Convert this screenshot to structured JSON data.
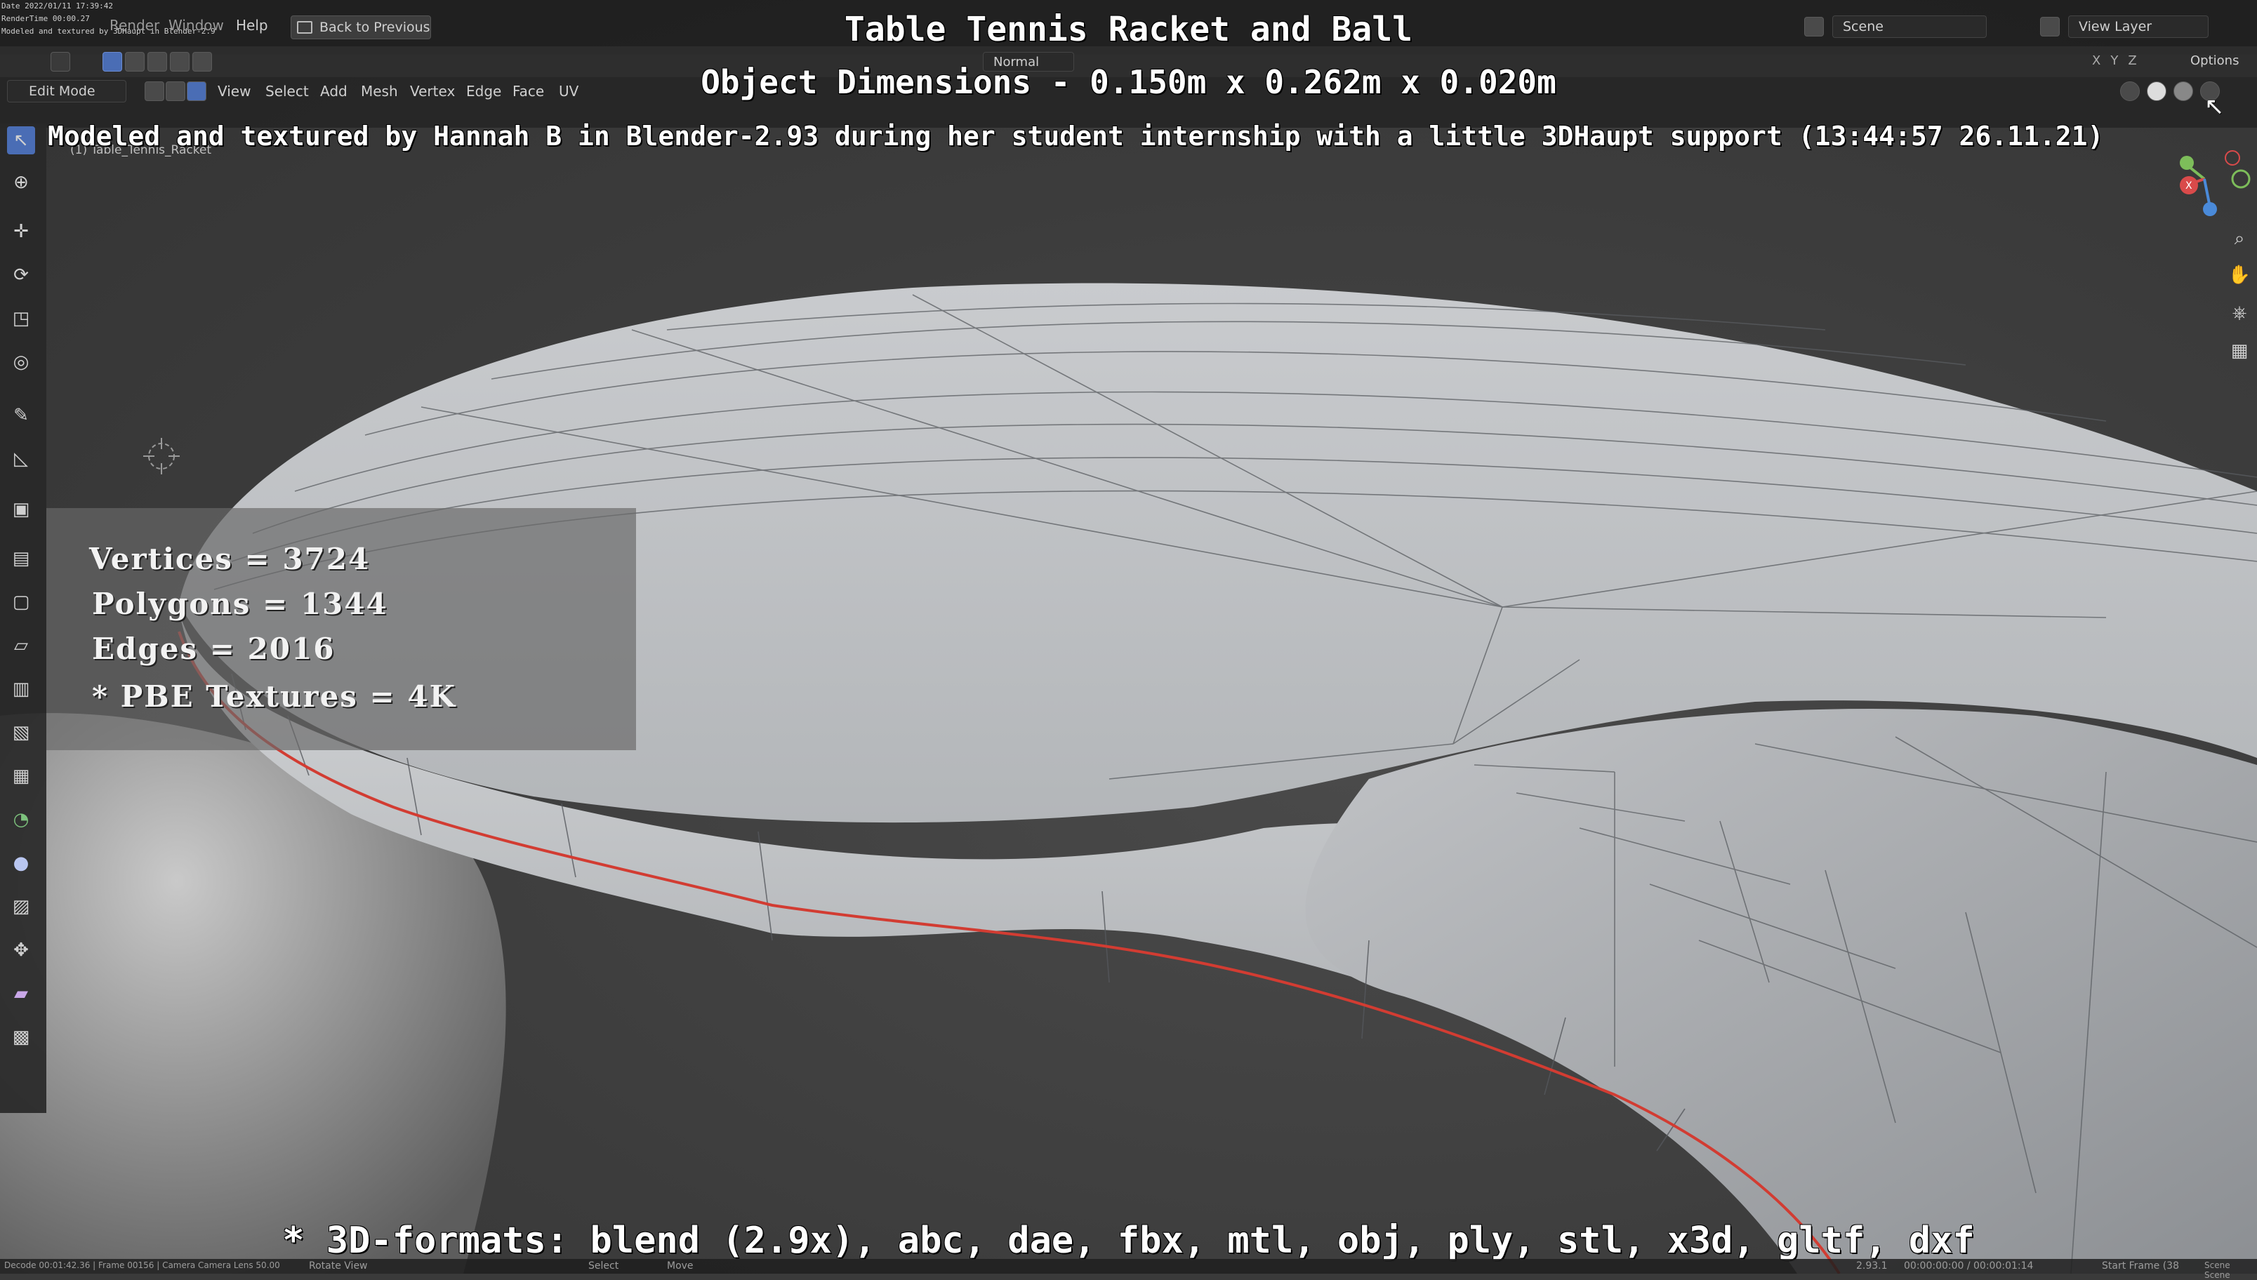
{
  "overlay": {
    "title": "Table Tennis Racket and Ball",
    "dimensions": "Object Dimensions -  0.150m x 0.262m x 0.020m",
    "credit": "Modeled and textured by Hannah B in Blender-2.93 during her student internship with a little 3DHaupt support (13:44:57 26.11.21)",
    "formats": "* 3D-formats: blend (2.9x), abc, dae, fbx, mtl, obj, ply, stl, x3d, gltf, dxf"
  },
  "stamp": {
    "date": "Date 2022/01/11 17:39:42",
    "render_time": "RenderTime 00:00.27",
    "modeled": "Modeled and textured by 3DHaupt in Blender-2.9"
  },
  "topbar": {
    "menus": [
      "Render",
      "Window",
      "Help"
    ],
    "back_label": "Back to Previous",
    "scene_label": "Scene",
    "view_layer_label": "View Layer",
    "options_label": "Options",
    "orientation_label": "Normal",
    "axes": [
      "X",
      "Y",
      "Z"
    ]
  },
  "header": {
    "mode_label": "Edit Mode",
    "menus": [
      "View",
      "Select",
      "Add",
      "Mesh",
      "Vertex",
      "Edge",
      "Face",
      "UV"
    ],
    "object_label": "(1) Table_Tennis_Racket"
  },
  "stats": {
    "vertices": "Vertices = 3724",
    "polygons": "Polygons = 1344",
    "edges": "Edges = 2016",
    "textures": "* PBE Textures = 4K"
  },
  "statusbar": {
    "left": "Decode 00:01:42.36 | Frame 00156 | Camera Camera   Lens 50.00",
    "rotate": "Rotate View",
    "select": "Select",
    "move": "Move",
    "version": "2.93.1",
    "time": "00:00:00:00 / 00:00:01:14",
    "start_frame": "Start Frame (38",
    "scene": "Scene  Scene"
  },
  "colors": {
    "accent": "#4a6db5",
    "seam": "#d23c32",
    "mesh_surface": "#c4c6c9",
    "overlay_text": "#ffffff"
  }
}
